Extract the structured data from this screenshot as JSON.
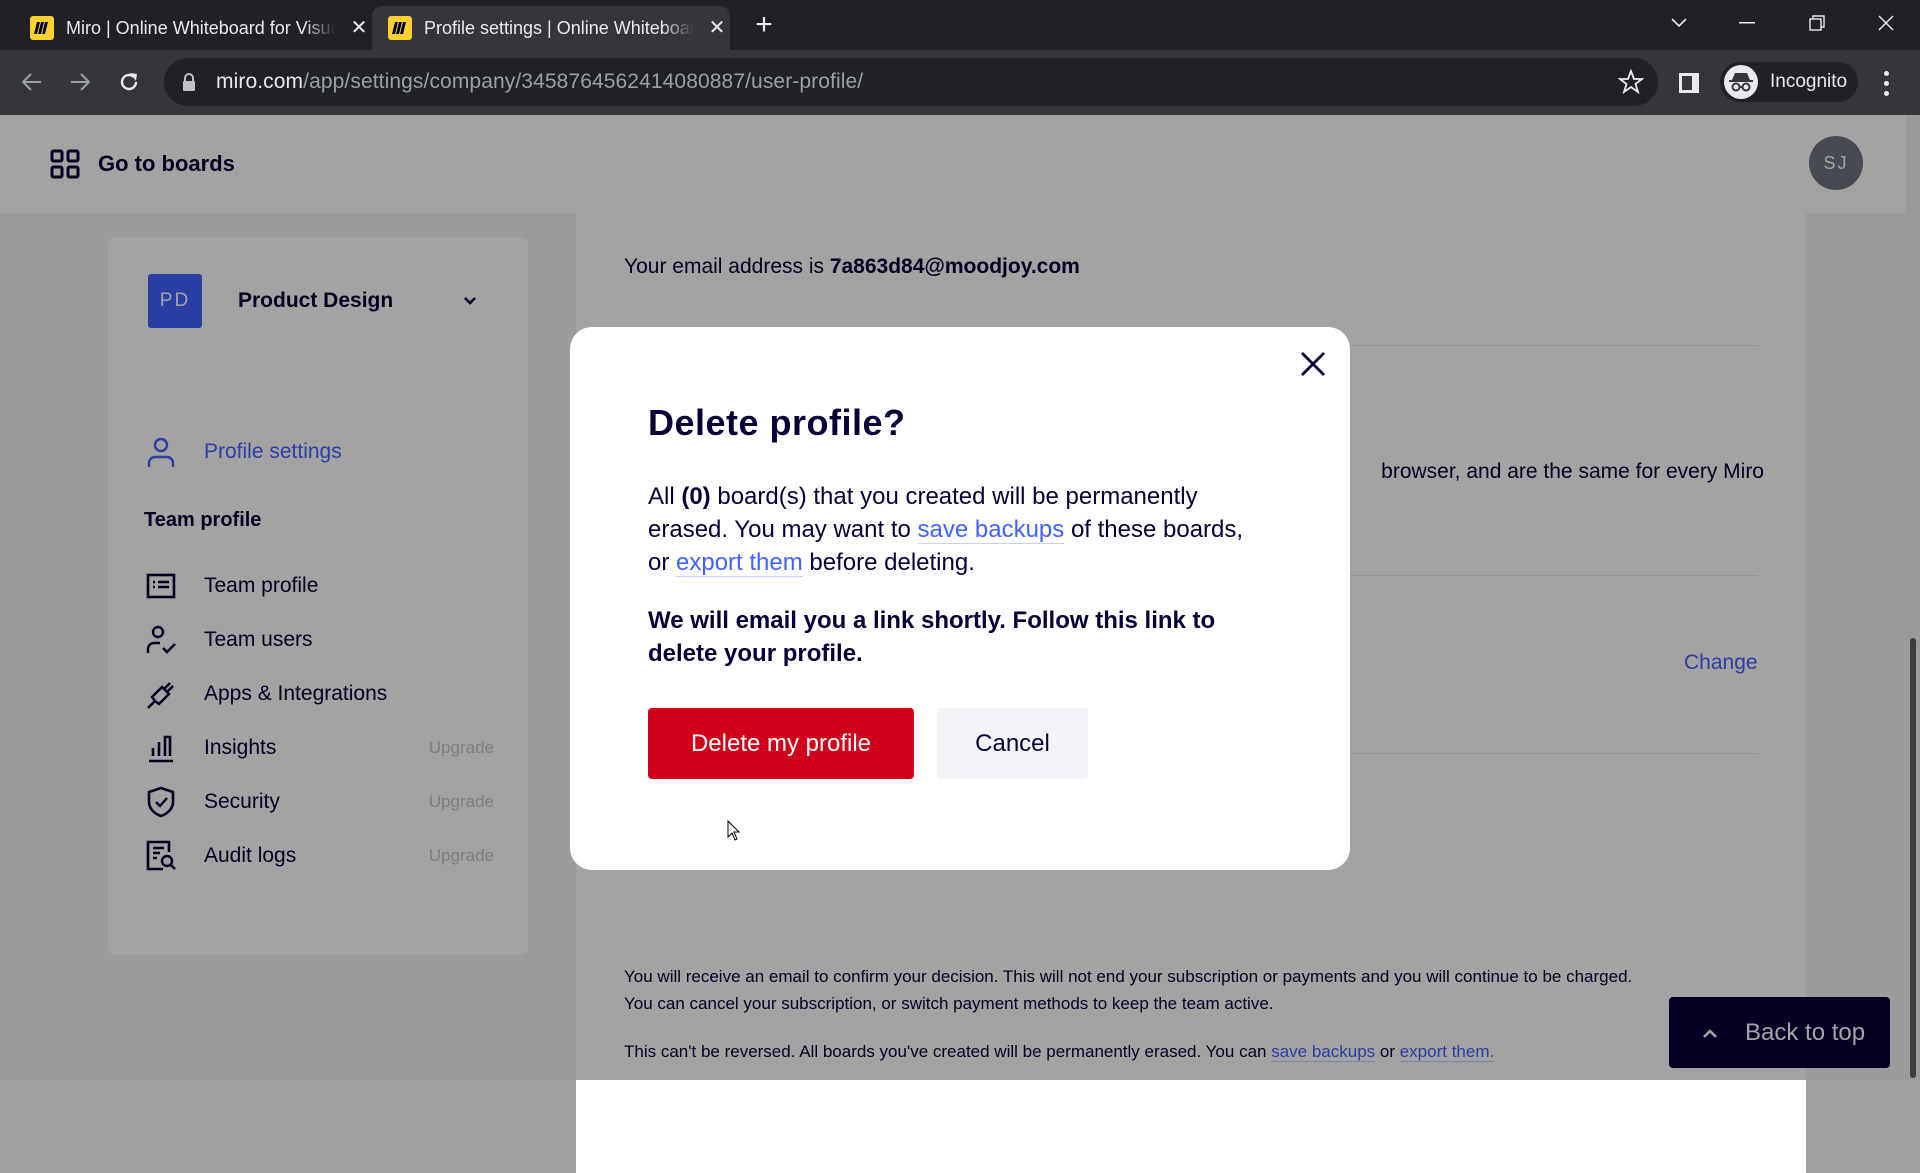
{
  "browser": {
    "tabs": [
      {
        "title": "Miro | Online Whiteboard for Visual Collaboration",
        "favicon": "miro-logo-icon",
        "active": false
      },
      {
        "title": "Profile settings | Online Whiteboard for Visual Collaboration",
        "favicon": "miro-logo-icon",
        "active": true
      }
    ],
    "new_tab_icon": "plus-icon",
    "url_host": "miro.com",
    "url_path": "/app/settings/company/3458764562414080887/user-profile/",
    "incognito_label": "Incognito",
    "window_controls": [
      "tab-search-icon",
      "minimize-icon",
      "restore-icon",
      "close-icon"
    ]
  },
  "header": {
    "go_to_boards": "Go to boards",
    "avatar_initials": "SJ"
  },
  "sidebar": {
    "team": {
      "initials": "PD",
      "name": "Product Design"
    },
    "profile_item": {
      "label": "Profile settings",
      "icon": "user-icon"
    },
    "section_title": "Team profile",
    "items": [
      {
        "label": "Team profile",
        "icon": "id-card-icon",
        "badge": ""
      },
      {
        "label": "Team users",
        "icon": "user-check-icon",
        "badge": ""
      },
      {
        "label": "Apps & Integrations",
        "icon": "plug-icon",
        "badge": ""
      },
      {
        "label": "Insights",
        "icon": "bar-chart-icon",
        "badge": "Upgrade"
      },
      {
        "label": "Security",
        "icon": "shield-check-icon",
        "badge": "Upgrade"
      },
      {
        "label": "Audit logs",
        "icon": "document-search-icon",
        "badge": "Upgrade"
      }
    ]
  },
  "content": {
    "email_prefix": "Your email address is ",
    "email": "7a863d84@moodjoy.com",
    "cookie_fragment": "browser, and are the same for every Miro",
    "change_link": "Change",
    "notice_1": "You will receive an email to confirm your decision. This will not end your subscription or payments and you will continue to be charged.",
    "notice_2": "You can cancel your subscription, or switch payment methods to keep the team active.",
    "notice_3_prefix": "This can't be reversed. All boards you've created will be permanently erased. You can ",
    "notice_3_link1": "save backups",
    "notice_3_mid": " or ",
    "notice_3_link2": "export them.",
    "back_to_top": "Back to top"
  },
  "modal": {
    "title": "Delete profile?",
    "body_prefix": "All ",
    "board_count": "(0)",
    "body_mid1": " board(s) that you created will be permanently erased. You may want to ",
    "link_save_backups": "save backups",
    "body_mid2": " of these boards, or ",
    "link_export": "export them",
    "body_suffix": " before deleting.",
    "warning": "We will email you a link shortly. Follow this link to delete your profile.",
    "delete_button": "Delete my profile",
    "cancel_button": "Cancel",
    "colors": {
      "danger": "#d0021b",
      "link": "#4262ff",
      "text": "#050038"
    }
  }
}
